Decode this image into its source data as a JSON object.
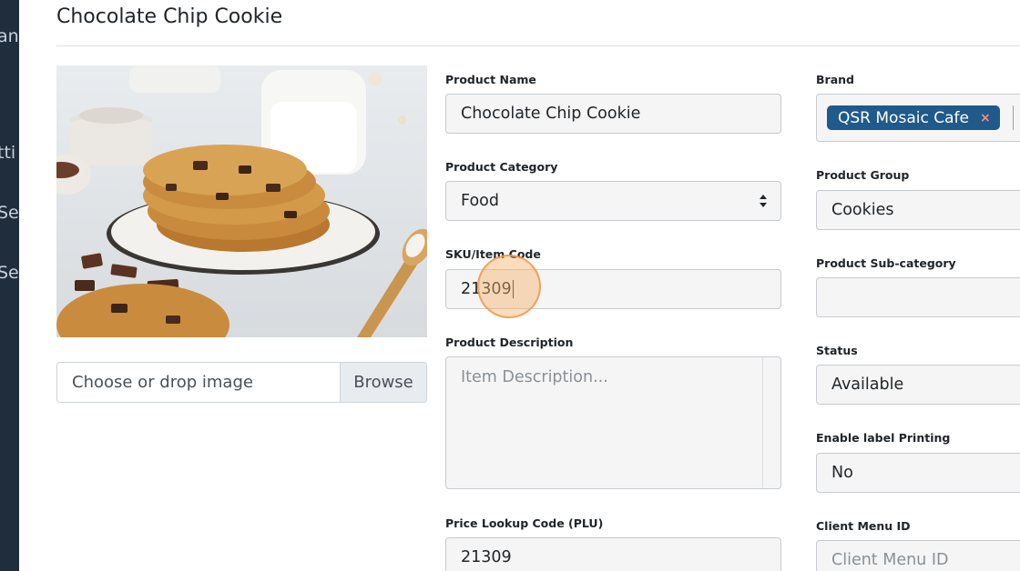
{
  "sidebar": {
    "fragments": [
      "an",
      "tti",
      "Se",
      "Se"
    ]
  },
  "page": {
    "title": "Chocolate Chip Cookie"
  },
  "image_upload": {
    "placeholder": "Choose or drop image",
    "browse_label": "Browse"
  },
  "form": {
    "product_name": {
      "label": "Product Name",
      "value": "Chocolate Chip Cookie"
    },
    "product_category": {
      "label": "Product Category",
      "value": "Food"
    },
    "sku": {
      "label": "SKU/Item Code",
      "value": "21309"
    },
    "product_description": {
      "label": "Product Description",
      "placeholder": "Item Description..."
    },
    "plu": {
      "label": "Price Lookup Code (PLU)",
      "value": "21309"
    },
    "brand": {
      "label": "Brand",
      "tag": "QSR Mosaic Cafe",
      "remove_glyph": "×"
    },
    "product_group": {
      "label": "Product Group",
      "value": "Cookies"
    },
    "product_subcategory": {
      "label": "Product Sub-category",
      "value": ""
    },
    "status": {
      "label": "Status",
      "value": "Available"
    },
    "label_printing": {
      "label": "Enable label Printing",
      "value": "No"
    },
    "client_menu_id": {
      "label": "Client Menu ID",
      "placeholder": "Client Menu ID"
    }
  },
  "colors": {
    "sidebar": "#1f2d3d",
    "brand_tag": "#1f5a8b",
    "click_indicator": "#f6b26b"
  }
}
